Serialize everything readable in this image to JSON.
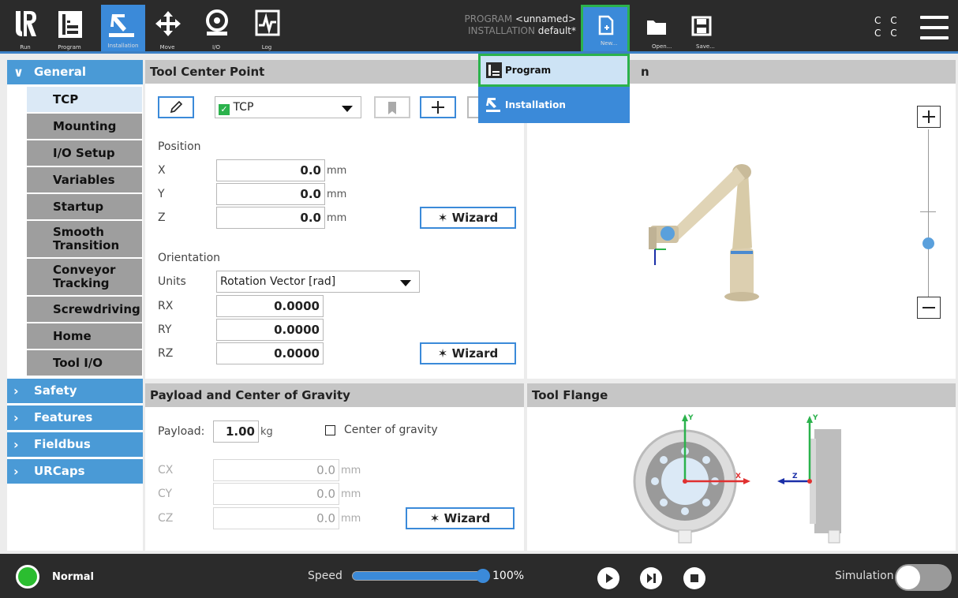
{
  "nav": {
    "run_label": "Run",
    "program_label": "Program",
    "installation_label": "Installation",
    "move_label": "Move",
    "io_label": "I/O",
    "log_label": "Log"
  },
  "program_info": {
    "program_key": "PROGRAM",
    "program_value": "<unnamed>",
    "installation_key": "INSTALLATION",
    "installation_value": "default*"
  },
  "file_buttons": {
    "new_label": "New...",
    "open_label": "Open...",
    "save_label": "Save..."
  },
  "cc": {
    "line1": "C C",
    "line2": "C C"
  },
  "new_menu": {
    "program_label": "Program",
    "installation_label": "Installation"
  },
  "sidebar": {
    "general": "General",
    "general_items": [
      "TCP",
      "Mounting",
      "I/O Setup",
      "Variables",
      "Startup",
      "Smooth Transition",
      "Conveyor Tracking",
      "Screwdriving",
      "Home",
      "Tool I/O"
    ],
    "sections": [
      "Safety",
      "Features",
      "Fieldbus",
      "URCaps"
    ]
  },
  "tcp_panel": {
    "title": "Tool Center Point",
    "tcp_select": "TCP",
    "position_label": "Position",
    "x_label": "X",
    "x_value": "0.0",
    "y_label": "Y",
    "y_value": "0.0",
    "z_label": "Z",
    "z_value": "0.0",
    "unit_mm": "mm",
    "wizard_label": "Wizard",
    "orientation_label": "Orientation",
    "units_label": "Units",
    "units_value": "Rotation Vector [rad]",
    "rx_label": "RX",
    "rx_value": "0.0000",
    "ry_label": "RY",
    "ry_value": "0.0000",
    "rz_label": "RZ",
    "rz_value": "0.0000"
  },
  "view_panel": {
    "title_fragment": "n"
  },
  "payload_panel": {
    "title": "Payload and Center of Gravity",
    "payload_label": "Payload:",
    "payload_value": "1.00",
    "payload_unit": "kg",
    "cog_label": "Center of gravity",
    "cx_label": "CX",
    "cx_value": "0.0",
    "cy_label": "CY",
    "cy_value": "0.0",
    "cz_label": "CZ",
    "cz_value": "0.0",
    "unit_mm": "mm",
    "wizard_label": "Wizard"
  },
  "flange_panel": {
    "title": "Tool Flange",
    "axis_y": "Y",
    "axis_x": "X",
    "axis_z": "Z"
  },
  "bottom": {
    "status": "Normal",
    "speed_label": "Speed",
    "speed_value": "100%",
    "speed_fraction": 1.0,
    "simulation_label": "Simulation"
  },
  "colors": {
    "accent": "#3b8ad9",
    "highlight": "#2bb24c",
    "bar": "#2b2b2b"
  }
}
